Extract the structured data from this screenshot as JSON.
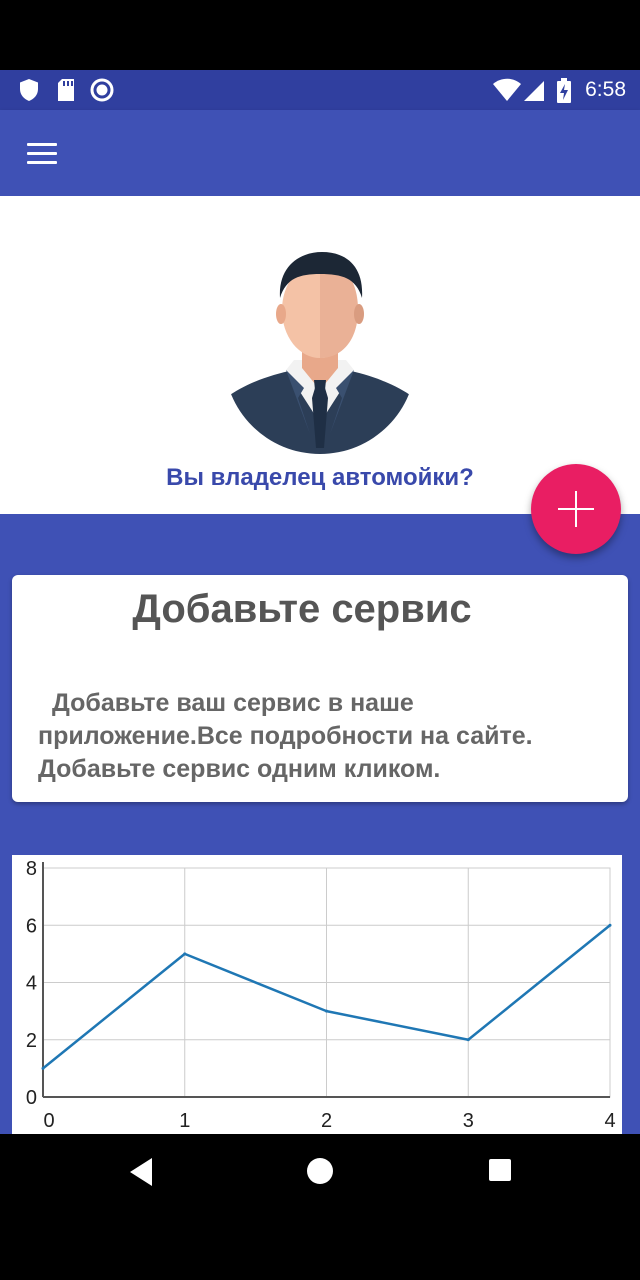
{
  "status_bar": {
    "time": "6:58",
    "icons": [
      "shield-icon",
      "sd-card-icon",
      "record-icon",
      "wifi-icon",
      "signal-icon",
      "battery-charging-icon"
    ]
  },
  "app_bar": {
    "menu_icon": "hamburger-menu-icon"
  },
  "profile": {
    "avatar_icon": "businessman-avatar-icon",
    "question": "Вы владелец автомойки?"
  },
  "fab": {
    "icon": "plus-icon",
    "color": "#e91e63"
  },
  "service_card": {
    "title": "Добавьте сервис",
    "line1": "Добавьте ваш сервис в наше",
    "line2": "приложение.Все подробности на сайте.",
    "line3": "Добавьте сервис одним кликом."
  },
  "chart_data": {
    "type": "line",
    "x": [
      0,
      1,
      2,
      3,
      4
    ],
    "series": [
      {
        "values": [
          1,
          5,
          3,
          2,
          6
        ],
        "color": "#1f77b4"
      }
    ],
    "x_ticks": [
      "0",
      "1",
      "2",
      "3",
      "4"
    ],
    "y_ticks": [
      "0",
      "2",
      "4",
      "6",
      "8"
    ],
    "xlim": [
      0,
      4
    ],
    "ylim": [
      0,
      8
    ],
    "grid": true
  },
  "nav_bar": {
    "back_icon": "back-triangle-icon",
    "home_icon": "home-circle-icon",
    "recents_icon": "recents-square-icon"
  },
  "colors": {
    "primary": "#3f51b5",
    "primary_dark": "#303f9f",
    "accent": "#e91e63"
  }
}
